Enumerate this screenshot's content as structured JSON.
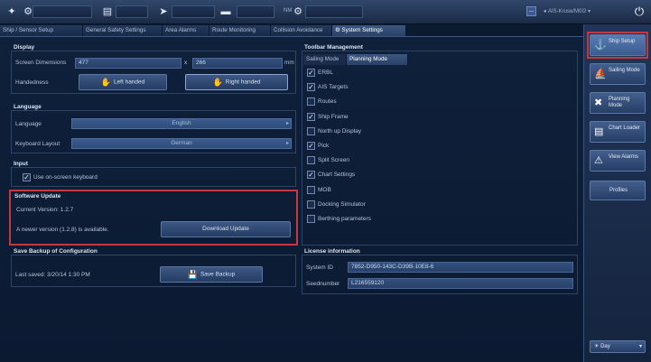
{
  "topbar": {
    "user": "AIS-Kruse/M0I2",
    "nm_label": "NM",
    "mini_label": "—",
    "user_caret": "▾",
    "power_icon": "power-icon"
  },
  "tabs": [
    {
      "label": "Ship / Sensor Setup"
    },
    {
      "label": "General Safety Settings"
    },
    {
      "label": "Area Alarms"
    },
    {
      "label": "Route Monitoring"
    },
    {
      "label": "Collision Avoidance"
    },
    {
      "label": "System Settings"
    }
  ],
  "display": {
    "title": "Display",
    "screen_dimensions_label": "Screen Dimensions",
    "width_value": "477",
    "x_sep": "x",
    "height_value": "266",
    "unit": "mm",
    "handedness_label": "Handedness",
    "left_handed": "Left handed",
    "right_handed": "Right handed"
  },
  "language": {
    "title": "Language",
    "language_label": "Language",
    "language_value": "English",
    "keyboard_label": "Keyboard Layout",
    "keyboard_value": "German"
  },
  "input": {
    "title": "Input",
    "onscreen_keyboard": "Use on-screen keyboard"
  },
  "software_update": {
    "title": "Software Update",
    "current_version": "Current Version: 1.2.7",
    "newer_version": "A newer version (1.2.8) is available.",
    "download": "Download Update"
  },
  "backup": {
    "title": "Save Backup of Configuration",
    "last_saved": "Last saved: 3/20/14 1:30 PM",
    "save": "Save Backup"
  },
  "toolbar_mgmt": {
    "title": "Toolbar Management",
    "tabs": [
      {
        "label": "Sailing Mode"
      },
      {
        "label": "Planning Mode"
      }
    ],
    "items": [
      {
        "label": "ERBL",
        "checked": true
      },
      {
        "label": "AIS Targets",
        "checked": true
      },
      {
        "label": "Routes",
        "checked": false
      },
      {
        "label": "Ship Frame",
        "checked": true
      },
      {
        "label": "North up Display",
        "checked": false
      },
      {
        "label": "Pick",
        "checked": true
      },
      {
        "label": "Split Screen",
        "checked": false
      },
      {
        "label": "Chart Settings",
        "checked": true
      },
      {
        "label": "MOB",
        "checked": false
      },
      {
        "label": "Docking Simulator",
        "checked": false
      },
      {
        "label": "Berthing parameters",
        "checked": false
      }
    ]
  },
  "license": {
    "title": "License information",
    "system_id_label": "System ID",
    "system_id_value": "7852-D950-143C-D39B-10E8-6",
    "seednumber_label": "Seednumber",
    "seednumber_value": "L216559120"
  },
  "sidebar": {
    "items": [
      {
        "label": "Ship Setup",
        "icon": "ship-setup-icon"
      },
      {
        "label": "Sailing Mode",
        "icon": "sailing-mode-icon"
      },
      {
        "label": "Planning Mode",
        "icon": "planning-mode-icon"
      },
      {
        "label": "Chart Loader",
        "icon": "chart-loader-icon"
      },
      {
        "label": "View Alarms",
        "icon": "alarm-icon"
      },
      {
        "label": "Profiles",
        "icon": ""
      }
    ],
    "day_label": "Day"
  },
  "colors": {
    "highlight": "#c4393f",
    "background": "#0c1a2f",
    "accent": "#3c5781"
  }
}
